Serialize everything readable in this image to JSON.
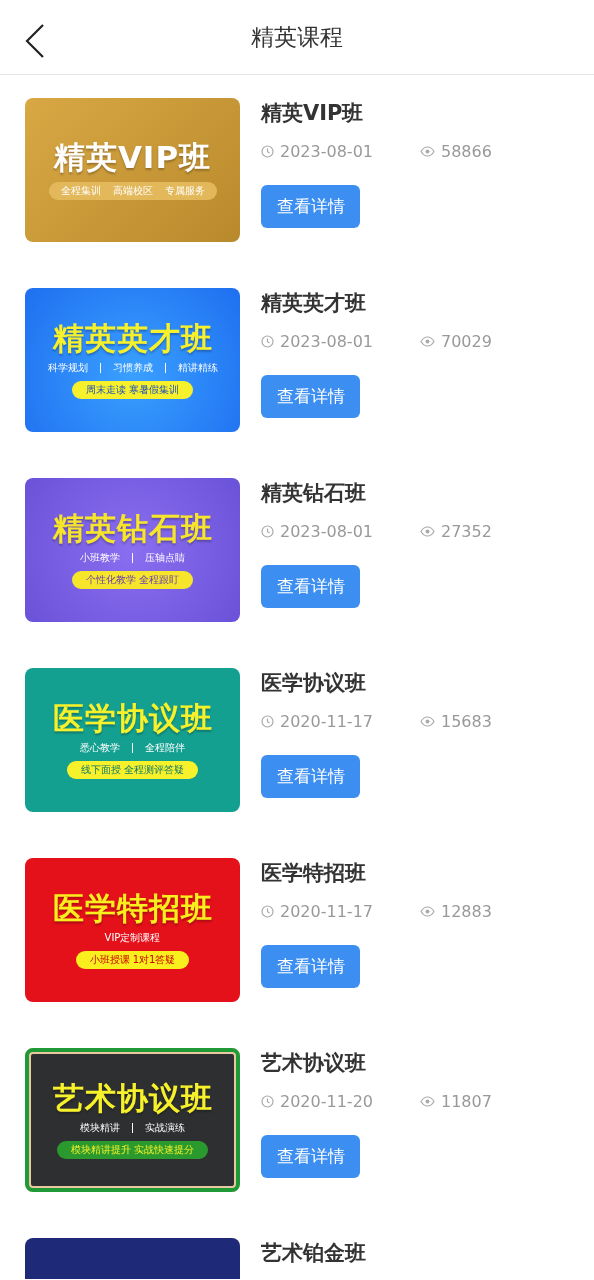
{
  "header": {
    "title": "精英课程"
  },
  "courses": [
    {
      "title": "精英VIP班",
      "date": "2023-08-01",
      "views": "58866",
      "button": "查看详情",
      "banner": {
        "kind": "gold",
        "title": "精英VIP班",
        "features": [
          "全程集训",
          "高端校区",
          "专属服务"
        ]
      }
    },
    {
      "title": "精英英才班",
      "date": "2023-08-01",
      "views": "70029",
      "button": "查看详情",
      "banner": {
        "kind": "blue",
        "title": "精英英才班",
        "features": [
          "科学规划",
          "习惯养成",
          "精讲精练"
        ],
        "tagline": "周末走读  寒暑假集训"
      }
    },
    {
      "title": "精英钻石班",
      "date": "2023-08-01",
      "views": "27352",
      "button": "查看详情",
      "banner": {
        "kind": "purple",
        "title": "精英钻石班",
        "features": [
          "小班教学",
          "压轴点睛"
        ],
        "tagline": "个性化教学  全程跟盯"
      }
    },
    {
      "title": "医学协议班",
      "date": "2020-11-17",
      "views": "15683",
      "button": "查看详情",
      "banner": {
        "kind": "teal",
        "title": "医学协议班",
        "features": [
          "悉心教学",
          "全程陪伴"
        ],
        "tagline": "线下面授  全程测评答疑"
      }
    },
    {
      "title": "医学特招班",
      "date": "2020-11-17",
      "views": "12883",
      "button": "查看详情",
      "banner": {
        "kind": "red",
        "title": "医学特招班",
        "features": [
          "VIP定制课程"
        ],
        "tagline": "小班授课  1对1答疑"
      }
    },
    {
      "title": "艺术协议班",
      "date": "2020-11-20",
      "views": "11807",
      "button": "查看详情",
      "banner": {
        "kind": "chalkboard",
        "title": "艺术协议班",
        "features": [
          "模块精讲",
          "实战演练"
        ],
        "tagline": "模块精讲提升  实战快速提分"
      }
    },
    {
      "title": "艺术铂金班",
      "banner": {
        "kind": "navy"
      }
    }
  ]
}
